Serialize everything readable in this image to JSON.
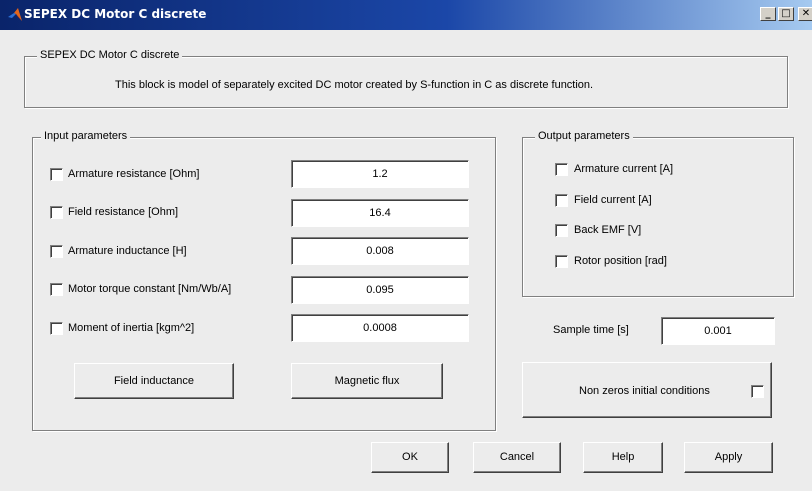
{
  "window": {
    "title": "SEPEX DC Motor C discrete",
    "minimize_glyph": "_",
    "maximize_glyph": "□",
    "close_glyph": "✕",
    "accent_color": "#0a246a",
    "icon": "matlab-logo-icon"
  },
  "description": {
    "legend": "SEPEX DC Motor C discrete",
    "text": "This block is model of separately excited DC motor created by S-function in C as discrete function."
  },
  "input_parameters": {
    "legend": "Input parameters",
    "rows": [
      {
        "label": "Armature resistance [Ohm]",
        "value": "1.2",
        "checked": false
      },
      {
        "label": "Field resistance [Ohm]",
        "value": "16.4",
        "checked": false
      },
      {
        "label": "Armature inductance [H]",
        "value": "0.008",
        "checked": false
      },
      {
        "label": "Motor torque constant [Nm/Wb/A]",
        "value": "0.095",
        "checked": false
      },
      {
        "label": "Moment of inertia [kgm^2]",
        "value": "0.0008",
        "checked": false
      }
    ],
    "field_inductance_button": "Field inductance",
    "magnetic_flux_button": "Magnetic flux"
  },
  "output_parameters": {
    "legend": "Output parameters",
    "items": [
      {
        "label": "Armature current [A]",
        "checked": false
      },
      {
        "label": "Field current [A]",
        "checked": false
      },
      {
        "label": "Back EMF [V]",
        "checked": false
      },
      {
        "label": "Rotor position [rad]",
        "checked": false
      }
    ]
  },
  "sample_time": {
    "label": "Sample time [s]",
    "value": "0.001"
  },
  "initial_conditions": {
    "label": "Non zeros initial conditions",
    "checked": false
  },
  "buttons": {
    "ok": "OK",
    "cancel": "Cancel",
    "help": "Help",
    "apply": "Apply"
  }
}
